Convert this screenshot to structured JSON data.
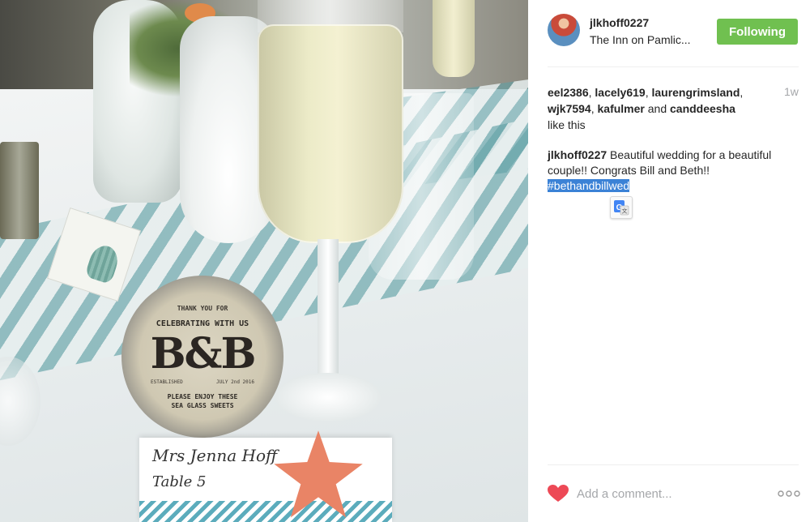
{
  "post": {
    "username": "jlkhoff0227",
    "location": "The Inn on Pamlic...",
    "follow_label": "Following",
    "timestamp": "1w",
    "likes": {
      "users": [
        "eel2386",
        "lacely619",
        "laurengrimsland",
        "wjk7594",
        "kafulmer"
      ],
      "and_word": "and",
      "last_user": "canddeesha",
      "suffix": "like this"
    },
    "caption": {
      "username": "jlkhoff0227",
      "text": "Beautiful wedding for a beautiful couple!! Congrats Bill and Beth!!",
      "hashtag": "#bethandbillwed"
    },
    "comment_placeholder": "Add a comment..."
  },
  "photo": {
    "jar_line1": "THANK YOU FOR",
    "jar_line2": "CELEBRATING WITH US",
    "jar_monogram": "B&B",
    "jar_est_left": "ESTABLISHED",
    "jar_est_right": "JULY 2nd 2016",
    "jar_line3": "PLEASE ENJOY THESE",
    "jar_line4": "SEA GLASS SWEETS",
    "card_name": "Mrs Jenna Hoff",
    "card_table": "Table 5"
  },
  "colors": {
    "follow_button": "#70c050",
    "heart": "#ed4956",
    "hashtag_highlight": "#3b82d6"
  },
  "icons": [
    "heart-icon",
    "more-options-icon",
    "translate-icon",
    "avatar"
  ]
}
